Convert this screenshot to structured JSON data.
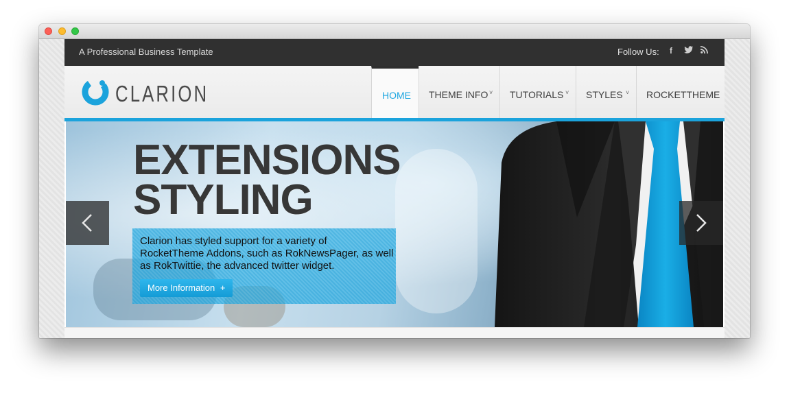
{
  "window": {
    "controls": [
      "close",
      "minimize",
      "zoom"
    ]
  },
  "topbar": {
    "tagline": "A Professional Business Template",
    "follow_label": "Follow Us:",
    "social": [
      {
        "icon": "facebook-icon",
        "glyph": "f"
      },
      {
        "icon": "twitter-icon",
        "glyph": "❧"
      },
      {
        "icon": "rss-icon",
        "glyph": "Ω"
      }
    ]
  },
  "header": {
    "logo_text": "CLARION",
    "nav": [
      {
        "label": "HOME",
        "active": true,
        "has_dropdown": false
      },
      {
        "label": "THEME INFO",
        "active": false,
        "has_dropdown": true
      },
      {
        "label": "TUTORIALS",
        "active": false,
        "has_dropdown": true
      },
      {
        "label": "STYLES",
        "active": false,
        "has_dropdown": true
      },
      {
        "label": "ROCKETTHEME",
        "active": false,
        "has_dropdown": false
      }
    ],
    "chevron_glyph": "˅"
  },
  "hero": {
    "title_line1": "EXTENSIONS",
    "title_line2": "STYLING",
    "caption": "Clarion has styled support for a variety of RocketTheme Addons, such as RokNewsPager, as well as RokTwittie, the advanced twitter widget.",
    "button_label": "More Information",
    "button_glyph": "+",
    "prev_icon": "chevron-left-icon",
    "next_icon": "chevron-right-icon"
  },
  "colors": {
    "accent": "#1ba3dc",
    "topbar_bg": "#303030",
    "title_text": "#373737"
  }
}
